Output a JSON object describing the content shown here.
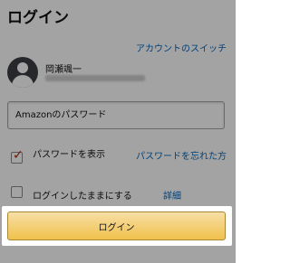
{
  "page": {
    "title": "ログイン",
    "switch_account": "アカウントのスイッチ",
    "user": {
      "name": "岡瀬颯一"
    },
    "password_placeholder": "Amazonのパスワード",
    "show_password_label": "パスワードを表示",
    "show_password_checked": true,
    "forgot_password": "パスワードを忘れた方",
    "keep_signed_in_label": "ログインしたままにする",
    "keep_signed_in_checked": false,
    "details_link": "詳細",
    "login_button": "ログイン"
  },
  "colors": {
    "link": "#0066c0",
    "button_top": "#f7dfa5",
    "button_bottom": "#f0c14b",
    "checkmark": "#b12704",
    "avatar": "#3a3d42"
  },
  "icons": [
    "avatar-icon",
    "checkmark-icon"
  ]
}
